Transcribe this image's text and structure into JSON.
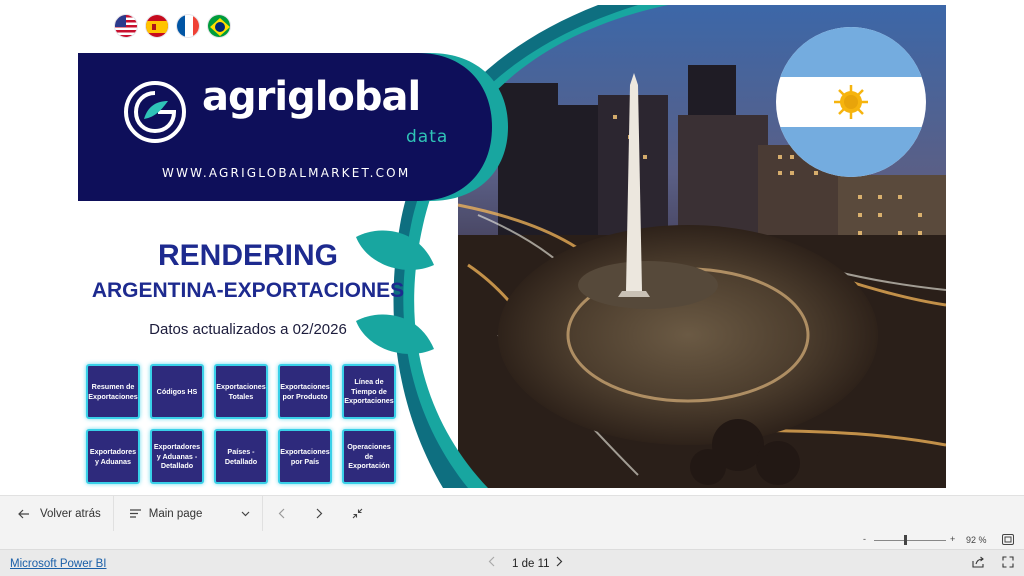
{
  "report": {
    "language_flags": [
      "usa-flag-icon",
      "spain-flag-icon",
      "france-flag-icon",
      "brazil-flag-icon"
    ],
    "logo": {
      "brand": "agriglobal",
      "sub": "data",
      "website": "WWW.AGRIGLOBALMARKET.COM"
    },
    "title_line1": "RENDERING",
    "title_line2": "ARGENTINA-EXPORTACIONES",
    "subtitle": "Datos actualizados a 02/2026",
    "nav_buttons": [
      "Resumen de Exportaciones",
      "Códigos HS",
      "Exportaciones Totales",
      "Exportaciones por Producto",
      "Línea de Tiempo de Exportaciones",
      "Exportadores y Aduanas",
      "Exportadores y Aduanas - Detallado",
      "Países - Detallado",
      "Exportaciones por País",
      "Operaciones de Exportación"
    ],
    "colors": {
      "navy": "#0e0f5a",
      "teal": "#18a6a0",
      "title": "#1d2a8f",
      "button_bg": "#2e2a7c",
      "button_border": "#39d0e8"
    }
  },
  "toolbar": {
    "back_label": "Volver atrás",
    "page_label": "Main page",
    "icons": [
      "arrow-left-icon",
      "list-icon",
      "chevron-down-icon",
      "chevron-left-icon",
      "chevron-right-icon",
      "collapse-icon"
    ]
  },
  "zoom": {
    "minus": "-",
    "plus": "+",
    "value": "92 %"
  },
  "status": {
    "powerbi_link": "Microsoft Power BI",
    "page_indicator": "1 de 11"
  }
}
